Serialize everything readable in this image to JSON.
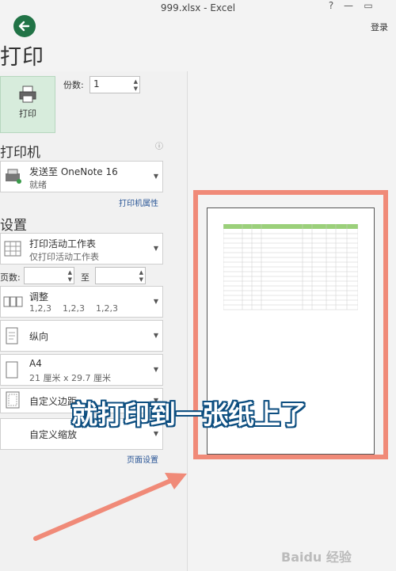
{
  "window": {
    "title": "999.xlsx - Excel",
    "help": "?",
    "minimize": "—",
    "restore": "▭",
    "sign_in": "登录"
  },
  "page": {
    "title": "打印"
  },
  "print_button": {
    "label": "打印"
  },
  "copies": {
    "label": "份数:",
    "value": "1"
  },
  "printer": {
    "heading": "打印机",
    "name": "发送至 OneNote 16",
    "status": "就绪",
    "properties_link": "打印机属性",
    "info_icon": "ⓘ"
  },
  "settings": {
    "heading": "设置",
    "scope": {
      "main": "打印活动工作表",
      "sub": "仅打印活动工作表"
    },
    "pages": {
      "label": "页数:",
      "to": "至"
    },
    "collate": {
      "main": "调整",
      "sub": "1,2,3    1,2,3    1,2,3"
    },
    "orientation": {
      "main": "纵向"
    },
    "paper": {
      "main": "A4",
      "sub": "21 厘米 x 29.7 厘米"
    },
    "margins": {
      "main": "自定义边距"
    },
    "scaling": {
      "main": "自定义缩放"
    },
    "page_setup_link": "页面设置"
  },
  "overlay": {
    "caption": "就打印到一张纸上了",
    "watermark": "Baidu 经验"
  },
  "colors": {
    "accent": "#217346",
    "highlight": "#f08a78",
    "caption_outline": "#0d4e80",
    "header_fill": "#9bd07a"
  }
}
